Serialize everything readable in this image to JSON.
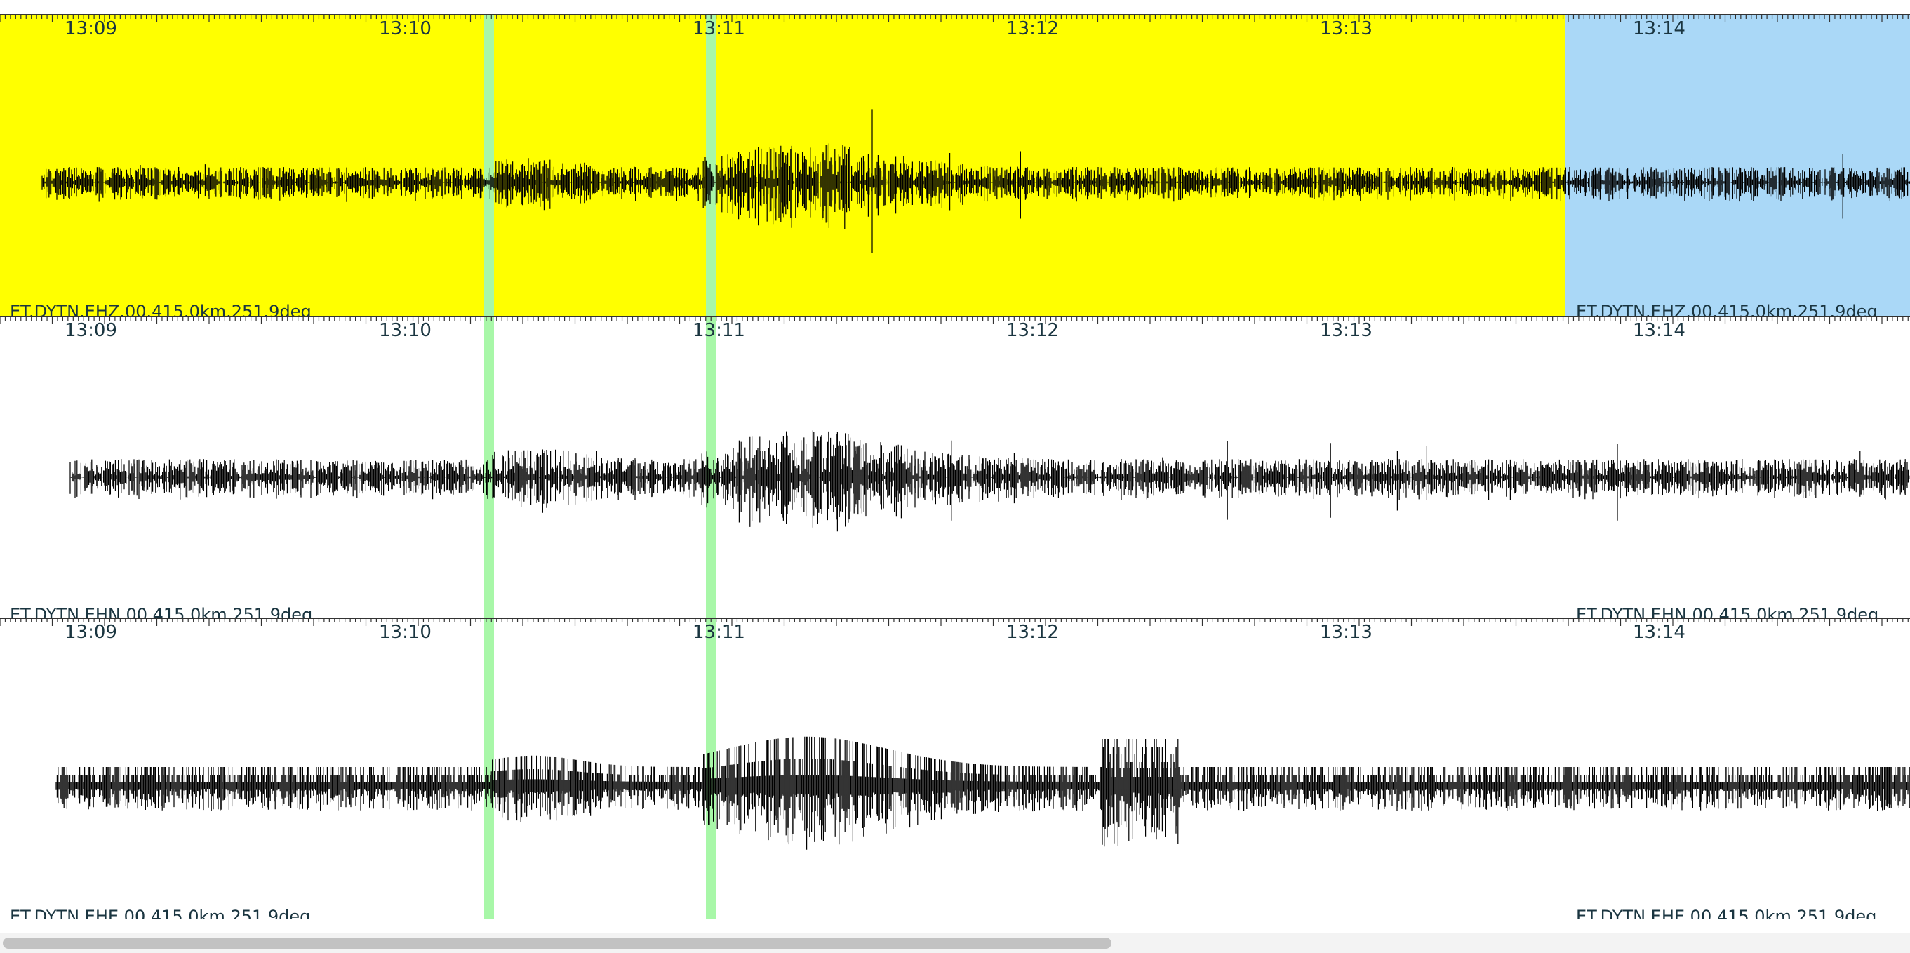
{
  "colors": {
    "selected_bg": "#ffff00",
    "future_bg": "#aad8f7",
    "pick_marker": "#a8f7a8",
    "trace": "#000000",
    "label_text": "#1a3540"
  },
  "time_ticks": [
    "13:09",
    "13:10",
    "13:11",
    "13:12",
    "13:13",
    "13:14"
  ],
  "traces": [
    {
      "channel_label": "ET.DYTN.EHZ.00.415.0km.251.9deg",
      "repeat_label": "ET.DYTN.EHZ.00.415.0km.251.9deg",
      "selected": true,
      "style": "normal",
      "noise_level": 0.22
    },
    {
      "channel_label": "ET.DYTN.EHN.00.415.0km.251.9deg",
      "repeat_label": "ET.DYTN.EHN.00.415.0km.251.9deg",
      "selected": false,
      "style": "normal",
      "noise_level": 0.26
    },
    {
      "channel_label": "ET.DYTN.EHE.00.415.0km.251.9deg",
      "repeat_label": "ET.DYTN.EHE.00.415.0km.251.9deg",
      "selected": false,
      "style": "quantized",
      "noise_level": 0.3
    }
  ],
  "icons": {
    "pick_marker": "vertical-band-icon",
    "scrollbar": "horizontal-scrollbar"
  }
}
